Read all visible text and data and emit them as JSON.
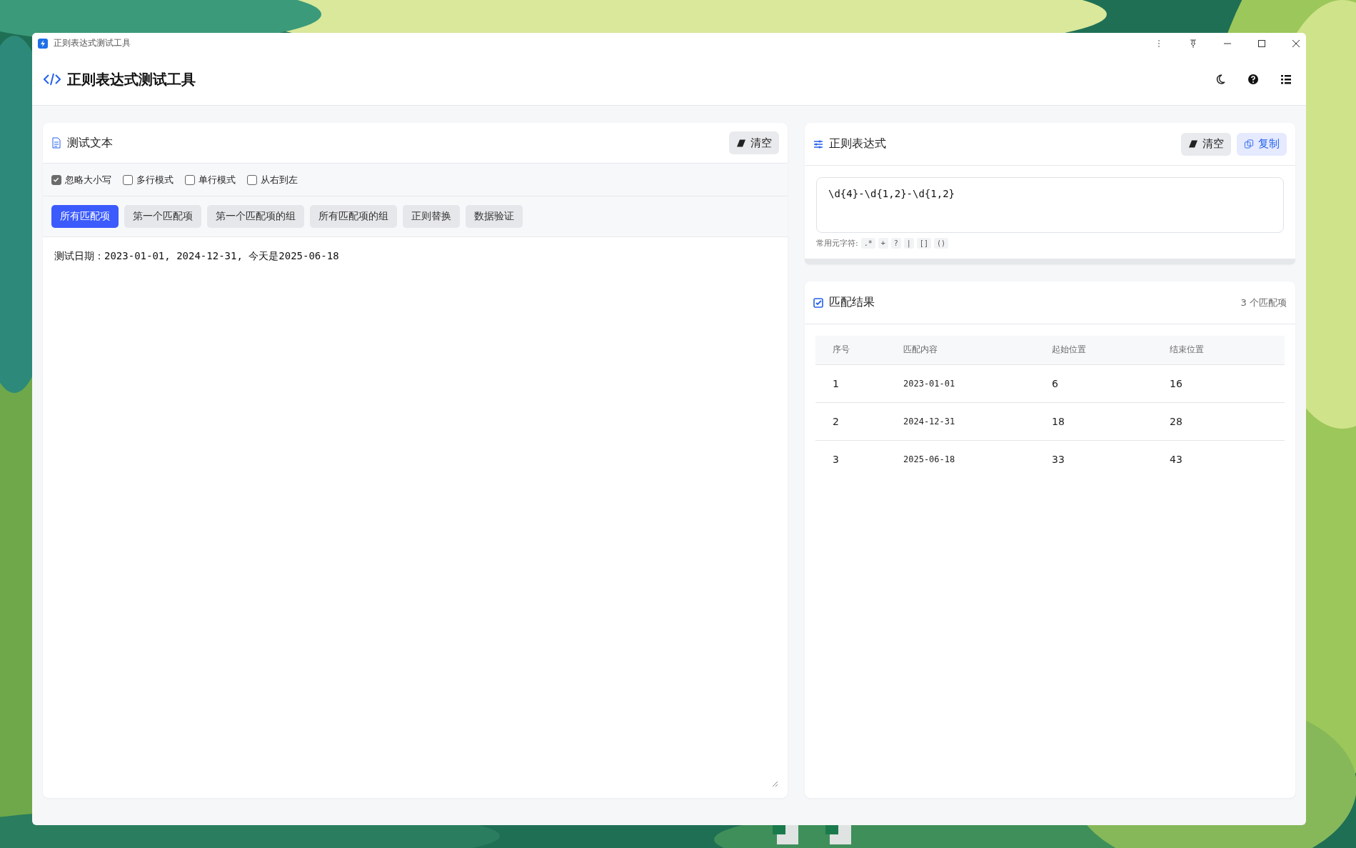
{
  "window": {
    "title": "正则表达式测试工具"
  },
  "header": {
    "title": "正则表达式测试工具"
  },
  "test_panel": {
    "title": "测试文本",
    "clear_button": "清空",
    "options": [
      {
        "label": "忽略大小写",
        "checked": true
      },
      {
        "label": "多行模式",
        "checked": false
      },
      {
        "label": "单行模式",
        "checked": false
      },
      {
        "label": "从右到左",
        "checked": false
      }
    ],
    "modes": [
      {
        "label": "所有匹配项",
        "selected": true
      },
      {
        "label": "第一个匹配项",
        "selected": false
      },
      {
        "label": "第一个匹配项的组",
        "selected": false
      },
      {
        "label": "所有匹配项的组",
        "selected": false
      },
      {
        "label": "正则替换",
        "selected": false
      },
      {
        "label": "数据验证",
        "selected": false
      }
    ],
    "text": "测试日期：2023-01-01, 2024-12-31, 今天是2025-06-18"
  },
  "regex_panel": {
    "title": "正则表达式",
    "buttons": [
      {
        "label": "清空",
        "kind": "clear"
      },
      {
        "label": "复制",
        "kind": "copy"
      }
    ],
    "pattern": "\\d{4}-\\d{1,2}-\\d{1,2}",
    "meta_label": "常用元字符:",
    "meta_chars": [
      ".*",
      "+",
      "?",
      "|",
      "[]",
      "()"
    ]
  },
  "results": {
    "title": "匹配结果",
    "count": "3 个匹配项",
    "columns": [
      "序号",
      "匹配内容",
      "起始位置",
      "结束位置"
    ],
    "rows": [
      [
        "1",
        "2023-01-01",
        "6",
        "16"
      ],
      [
        "2",
        "2024-12-31",
        "18",
        "28"
      ],
      [
        "3",
        "2025-06-18",
        "33",
        "43"
      ]
    ]
  }
}
